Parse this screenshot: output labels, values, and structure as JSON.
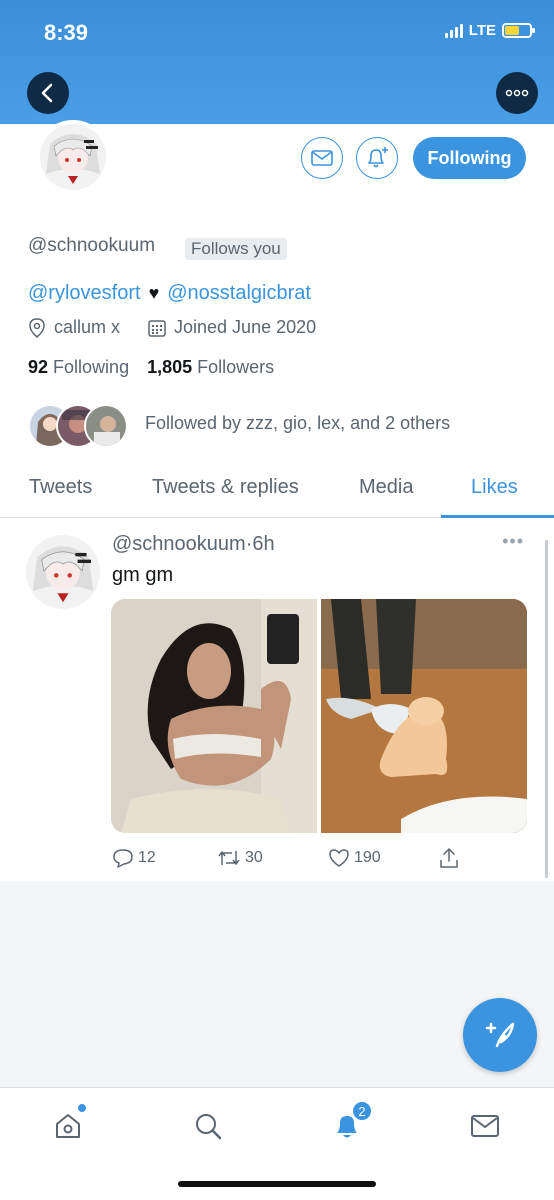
{
  "status_bar": {
    "time": "8:39",
    "network": "LTE"
  },
  "profile": {
    "handle": "@schnookuum",
    "follows_you": "Follows you",
    "following_button": "Following",
    "bio_link_1": "@rylovesfort",
    "bio_heart": "♥",
    "bio_link_2": "@nosstalgicbrat",
    "location": "callum x",
    "joined": "Joined June 2020",
    "following_count": "92",
    "following_label": "Following",
    "followers_count": "1,805",
    "followers_label": "Followers",
    "followed_by": "Followed by zzz, gio, lex, and 2 others"
  },
  "tabs": [
    {
      "label": "Tweets"
    },
    {
      "label": "Tweets & replies"
    },
    {
      "label": "Media"
    },
    {
      "label": "Likes"
    }
  ],
  "tweet": {
    "handle": "@schnookuum",
    "separator": "·",
    "time": "6h",
    "more": "•••",
    "text": "gm gm",
    "replies": "12",
    "retweets": "30",
    "likes": "190"
  },
  "bottom_nav": {
    "notifications_badge": "2"
  },
  "colors": {
    "accent": "#3a94e0",
    "header": "#4a9ee6"
  },
  "icons": [
    "chevron-left-icon",
    "more-icon",
    "mail-icon",
    "bell-plus-icon",
    "location-icon",
    "calendar-icon",
    "reply-icon",
    "retweet-icon",
    "heart-icon",
    "share-icon",
    "compose-icon",
    "home-icon",
    "search-icon",
    "bell-icon",
    "inbox-icon"
  ]
}
